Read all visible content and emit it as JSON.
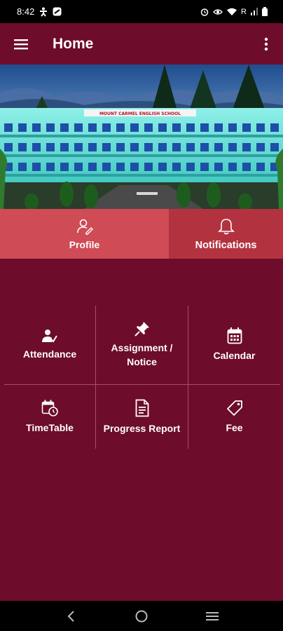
{
  "status_bar": {
    "time": "8:42",
    "signal_label": "R"
  },
  "app_bar": {
    "title": "Home"
  },
  "banner": {
    "school_sign": "MOUNT CARMEL ENGLISH SCHOOL"
  },
  "tabs": [
    {
      "label": "Profile",
      "icon": "user-edit-icon"
    },
    {
      "label": "Notifications",
      "icon": "bell-icon"
    }
  ],
  "grid": {
    "items": [
      {
        "label": "Attendance",
        "icon": "user-check-icon"
      },
      {
        "label_line1": "Assignment /",
        "label_line2": "Notice",
        "icon": "pushpin-icon"
      },
      {
        "label": "Calendar",
        "icon": "calendar-icon"
      },
      {
        "label": "TimeTable",
        "icon": "calendar-clock-icon"
      },
      {
        "label": "Progress Report",
        "icon": "document-icon"
      },
      {
        "label": "Fee",
        "icon": "tag-icon"
      }
    ]
  },
  "colors": {
    "background": "#6d0c2b",
    "tab_active": "#cf4b55",
    "tab_inactive": "#b3323f",
    "divider": "#a5506a"
  }
}
